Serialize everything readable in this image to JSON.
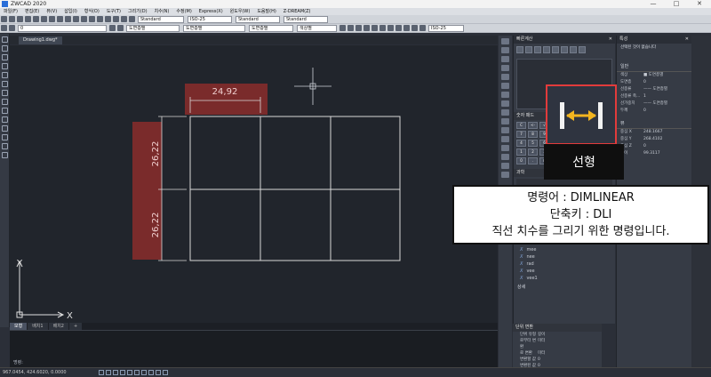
{
  "window": {
    "title": "ZWCAD 2020",
    "controls": [
      "—",
      "□",
      "✕"
    ]
  },
  "menu": [
    "파일(F)",
    "편집(E)",
    "뷰(V)",
    "삽입(I)",
    "형식(O)",
    "도구(T)",
    "그리기(D)",
    "치수(N)",
    "수정(M)",
    "Express(X)",
    "윈도우(W)",
    "도움말(H)",
    "Z-DREAM(Z)"
  ],
  "toolbar": {
    "text_style": "Standard",
    "dim_style": "ISO-25",
    "table_style": "Standard",
    "multileader_style": "Standard",
    "layer": "0",
    "color": "도면층별",
    "linetype": "도면층별",
    "lineweight": "도면층별",
    "plotstyle": "색상별",
    "dim_style_right": "ISO-25"
  },
  "document": {
    "tab_label": "Drawing1.dwg*"
  },
  "canvas": {
    "dim_horizontal": "24,92",
    "dim_vertical_top": "26,22",
    "dim_vertical_bottom": "26,22",
    "axis_x": "X",
    "axis_y": "Y"
  },
  "layout_tabs": [
    "모형",
    "배치1",
    "배치2",
    "+"
  ],
  "command": {
    "prompt": "명령:"
  },
  "status": {
    "coordinates": "967.0454, 424.6020, 0.0000"
  },
  "quick_calc": {
    "title": "빠른계산",
    "numpad_title": "숫자 패드",
    "keypad": [
      "C",
      "<-",
      "√",
      "/",
      "7",
      "8",
      "9",
      "*",
      "4",
      "5",
      "6",
      "-",
      "1",
      "2",
      "3",
      "+",
      "0",
      ".",
      "π",
      "="
    ],
    "scientific_title": "과학",
    "variables": [
      "dle",
      "mee",
      "nee",
      "rad",
      "vee",
      "vee1"
    ],
    "details_label": "상세"
  },
  "unit_conversion": {
    "title": "단위 변환",
    "rows": [
      {
        "key": "단위 유형",
        "value": "길이"
      },
      {
        "key": "로부터 변환",
        "value": "미터"
      },
      {
        "key": "로 변환",
        "value": "미터"
      },
      {
        "key": "변환할 값",
        "value": "0"
      },
      {
        "key": "변환된 값",
        "value": "0"
      }
    ]
  },
  "properties": {
    "title": "특성",
    "selection": "선택된 것이 없습니다",
    "section_general": "일반",
    "rows": [
      {
        "key": "색상",
        "value": "■ 도면층별"
      },
      {
        "key": "도면층",
        "value": "0"
      },
      {
        "key": "선종류",
        "value": "—— 도면층별"
      },
      {
        "key": "선종류 축...",
        "value": "1"
      },
      {
        "key": "선가중치",
        "value": "—— 도면층별"
      },
      {
        "key": "두께",
        "value": "0"
      }
    ],
    "section_view": "뷰",
    "view_rows": [
      {
        "key": "중심 X",
        "value": "248.1667"
      },
      {
        "key": "중심 Y",
        "value": "268.4102"
      },
      {
        "key": "중심 Z",
        "value": "0"
      },
      {
        "key": "높이",
        "value": "99.3117"
      }
    ],
    "ucs_label": "UCS 이름"
  },
  "callout": {
    "tool_name": "선형",
    "line1": "명령어 : DIMLINEAR",
    "line2": "단축키 : DLI",
    "line3": "직선 치수를 그리기 위한 명령입니다."
  },
  "colors": {
    "dimension_highlight": "#7a2b2b",
    "callout_border": "#e23b3b",
    "canvas_bg": "#21252c"
  }
}
